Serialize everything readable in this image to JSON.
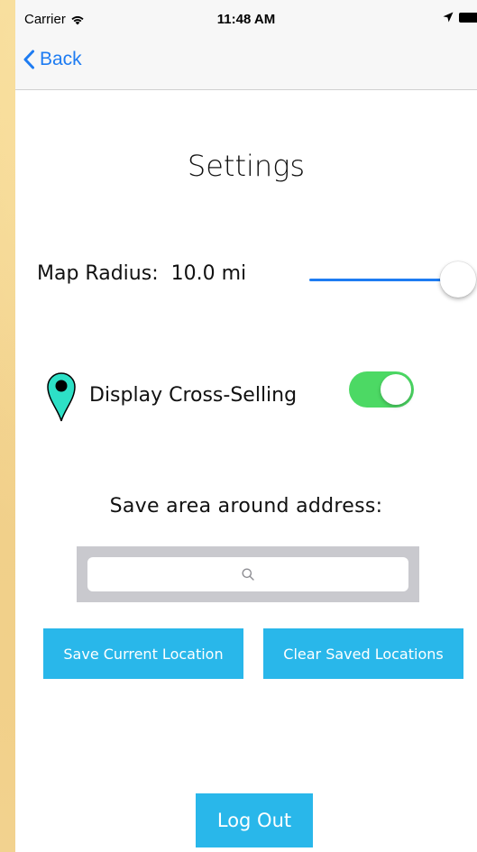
{
  "status_bar": {
    "carrier": "Carrier",
    "time": "11:48 AM"
  },
  "nav": {
    "back_label": "Back"
  },
  "page": {
    "title": "Settings"
  },
  "map_radius": {
    "label": "Map Radius:",
    "value": "10.0 mi",
    "slider_fraction": 1.0
  },
  "cross_selling": {
    "label": "Display Cross-Selling",
    "enabled": true
  },
  "save_area": {
    "label": "Save area around address:",
    "search_placeholder": ""
  },
  "buttons": {
    "save_current": "Save Current Location",
    "clear_saved": "Clear Saved Locations",
    "log_out": "Log Out"
  },
  "colors": {
    "accent_blue": "#1e7cf2",
    "button_blue": "#29b7ea",
    "toggle_green": "#4cd964",
    "pin_teal": "#2de0c6"
  },
  "icons": {
    "wifi": "wifi-icon",
    "location": "location-arrow-icon",
    "battery": "battery-icon",
    "back": "back-chevron-icon",
    "pin": "map-pin-icon",
    "search": "search-icon"
  }
}
